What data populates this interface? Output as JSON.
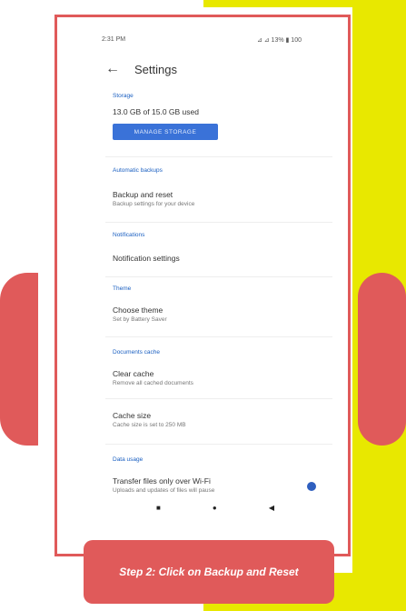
{
  "status_bar": {
    "time": "2:31 PM",
    "icons": "⊿ ⊿ 13% ▮ 100"
  },
  "header": {
    "title": "Settings"
  },
  "sections": [
    {
      "label": "Storage",
      "title": "13.0 GB of 15.0 GB used",
      "subtitle": "",
      "button": "MANAGE STORAGE"
    },
    {
      "label": "Automatic backups",
      "title": "Backup and reset",
      "subtitle": "Backup settings for your device"
    },
    {
      "label": "Notifications",
      "title": "Notification settings",
      "subtitle": ""
    },
    {
      "label": "Theme",
      "title": "Choose theme",
      "subtitle": "Set by Battery Saver"
    },
    {
      "label": "Documents cache",
      "title": "Clear cache",
      "subtitle": "Remove all cached documents"
    },
    {
      "label": "",
      "title": "Cache size",
      "subtitle": "Cache size is set to 250 MB"
    },
    {
      "label": "Data usage",
      "title": "Transfer files only over Wi-Fi",
      "subtitle": "Uploads and updates of files will pause"
    }
  ],
  "toggle": {
    "on": true,
    "color": "#2f5fbf"
  },
  "nav_bar": {
    "items": [
      "■",
      "●",
      "◀"
    ]
  },
  "caption": "Step 2: Click on Backup and Reset",
  "colors": {
    "accent": "#e05a5a",
    "yellow": "#e8e800",
    "blue": "#3a72d8"
  }
}
